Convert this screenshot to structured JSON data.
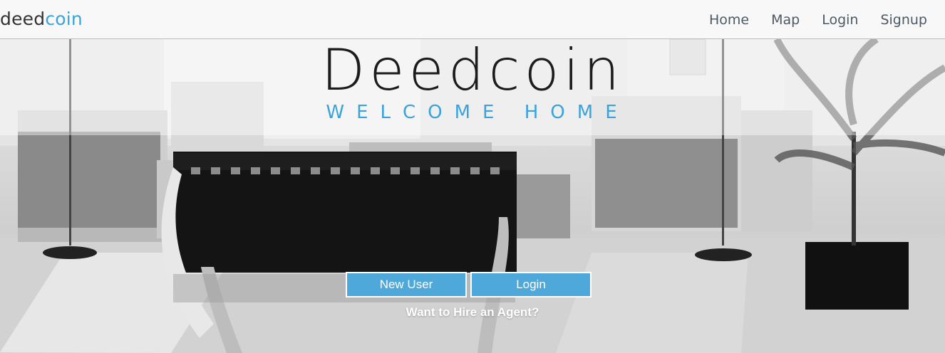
{
  "navbar": {
    "brand_part1": "deed",
    "brand_part2": "coin",
    "links": [
      "Home",
      "Map",
      "Login",
      "Signup"
    ]
  },
  "hero": {
    "title": "Deedcoin",
    "subtitle": "WELCOME HOME",
    "buttons": {
      "new_user": "New User",
      "login": "Login"
    },
    "agent_link": "Want to Hire an Agent?"
  },
  "colors": {
    "brand_blue": "#3aa3dc",
    "button_blue": "#4fa8da",
    "navbar_bg": "#f8f8f8",
    "text_dark": "#1c1c1c"
  }
}
